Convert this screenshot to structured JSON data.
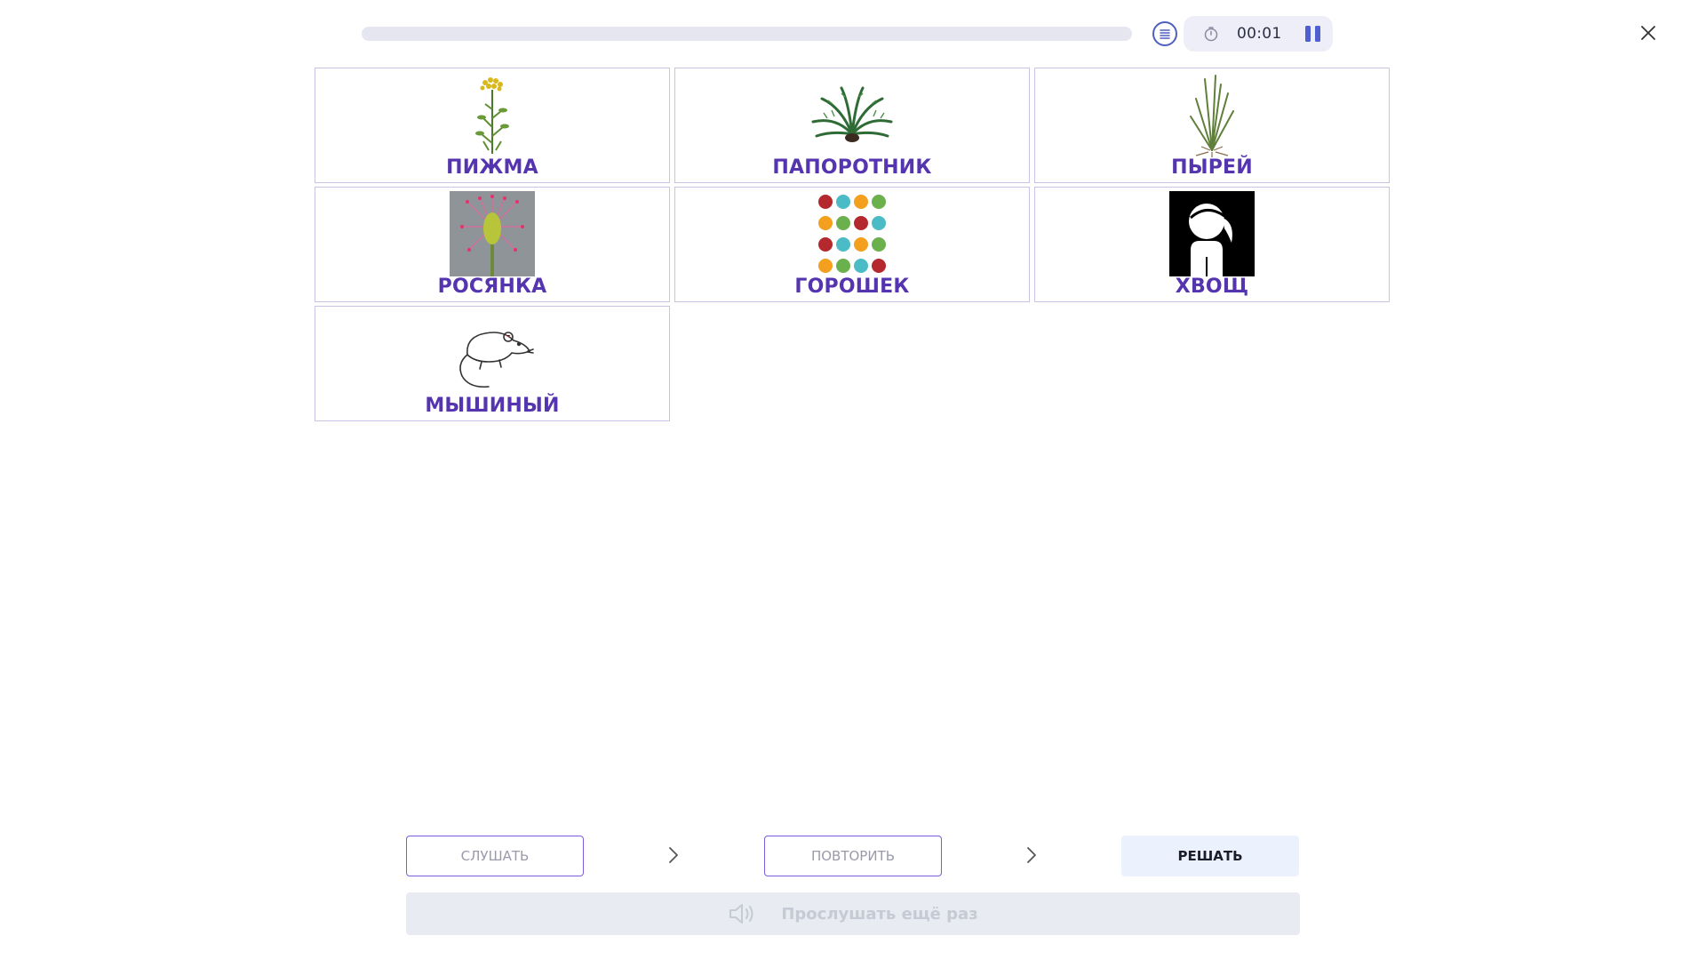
{
  "header": {
    "progress": 0,
    "timer": "00:01"
  },
  "cards": [
    {
      "label": "ПИЖМА",
      "icon": "tansy-plant-icon"
    },
    {
      "label": "ПАПОРОТНИК",
      "icon": "fern-icon"
    },
    {
      "label": "ПЫРЕЙ",
      "icon": "couch-grass-icon"
    },
    {
      "label": "РОСЯНКА",
      "icon": "sundew-plant-icon"
    },
    {
      "label": "ГОРОШЕК",
      "icon": "polka-dots-icon"
    },
    {
      "label": "ХВОЩ",
      "icon": "ponytail-girl-icon"
    },
    {
      "label": "МЫШИНЫЙ",
      "icon": "mouse-drawing-icon"
    }
  ],
  "controls": {
    "listen_label": "СЛУШАТЬ",
    "repeat_label": "ПОВТОРИТЬ",
    "solve_label": "РЕШАТЬ",
    "listen_again_label": "Прослушать ещё раз"
  },
  "colors": {
    "accent": "#5534b0",
    "button_border": "#7b5ee0",
    "solve_bg": "#ecf2fd"
  }
}
